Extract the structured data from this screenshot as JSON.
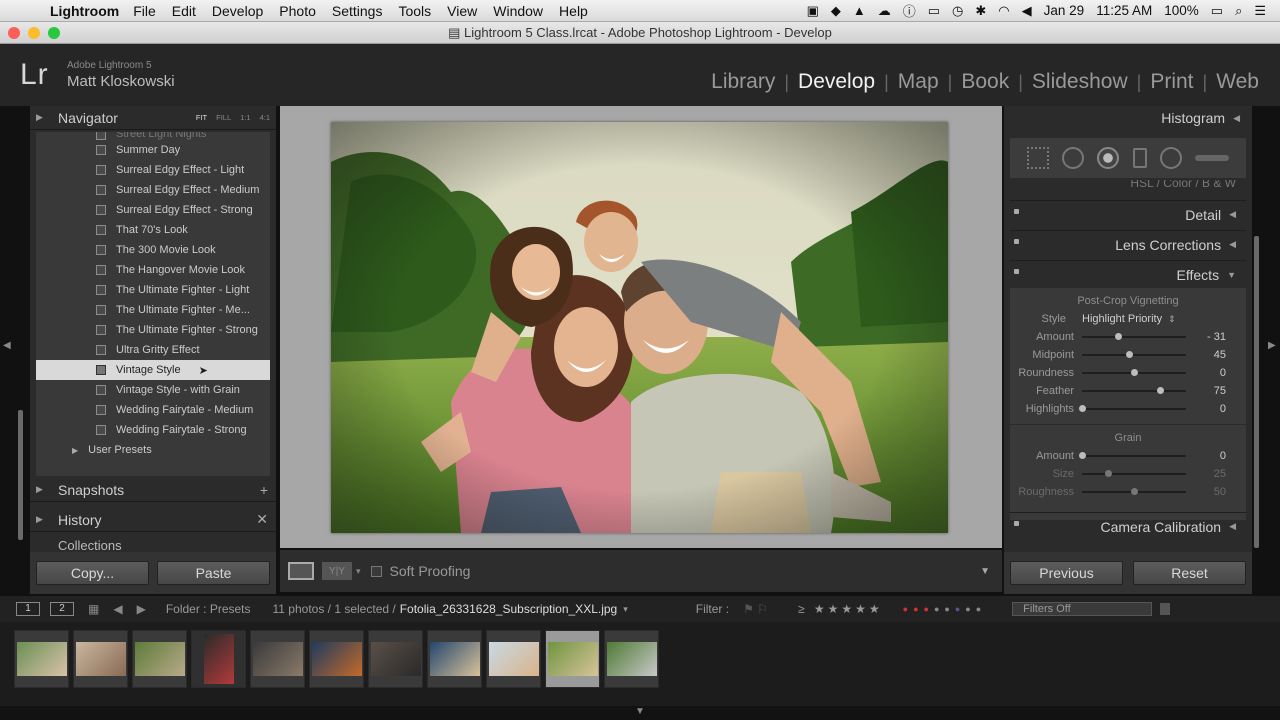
{
  "menubar": {
    "app": "Lightroom",
    "items": [
      "File",
      "Edit",
      "Develop",
      "Photo",
      "Settings",
      "Tools",
      "View",
      "Window",
      "Help"
    ],
    "date": "Jan 29",
    "time": "11:25 AM",
    "battery": "100%"
  },
  "window": {
    "title": "Lightroom 5 Class.lrcat - Adobe Photoshop Lightroom - Develop"
  },
  "identity": {
    "logo": "Lr",
    "version": "Adobe Lightroom 5",
    "user": "Matt Kloskowski"
  },
  "modules": [
    "Library",
    "Develop",
    "Map",
    "Book",
    "Slideshow",
    "Print",
    "Web"
  ],
  "left_panel": {
    "navigator": {
      "label": "Navigator",
      "zoom": [
        "FIT",
        "FILL",
        "1:1",
        "4:1"
      ]
    },
    "presets": [
      "Street Light Nights",
      "Summer Day",
      "Surreal Edgy Effect - Light",
      "Surreal Edgy Effect - Medium",
      "Surreal Edgy Effect - Strong",
      "That 70's Look",
      "The 300 Movie Look",
      "The Hangover Movie Look",
      "The Ultimate Fighter - Light",
      "The Ultimate Fighter - Me...",
      "The Ultimate Fighter - Strong",
      "Ultra Gritty Effect",
      "Vintage Style",
      "Vintage Style - with Grain",
      "Wedding Fairytale - Medium",
      "Wedding Fairytale - Strong"
    ],
    "user_presets": "User Presets",
    "snapshots": "Snapshots",
    "history": "History",
    "collections": "Collections",
    "copy_button": "Copy...",
    "paste_button": "Paste"
  },
  "toolbar": {
    "soft_proofing": "Soft Proofing",
    "yy": "Y|Y"
  },
  "right_panel": {
    "histogram": "Histogram",
    "hsl_tabs": "HSL  /  Color  /  B & W",
    "detail": "Detail",
    "lens_corrections": "Lens Corrections",
    "effects": {
      "label": "Effects",
      "vignette_title": "Post-Crop Vignetting",
      "style_label": "Style",
      "style_value": "Highlight Priority",
      "sliders": [
        {
          "label": "Amount",
          "value": "- 31",
          "pos": 0.345
        },
        {
          "label": "Midpoint",
          "value": "45",
          "pos": 0.45
        },
        {
          "label": "Roundness",
          "value": "0",
          "pos": 0.5
        },
        {
          "label": "Feather",
          "value": "75",
          "pos": 0.75
        },
        {
          "label": "Highlights",
          "value": "0",
          "pos": 0.0
        }
      ],
      "grain_title": "Grain",
      "grain": [
        {
          "label": "Amount",
          "value": "0",
          "pos": 0.0
        },
        {
          "label": "Size",
          "value": "25",
          "pos": 0.25
        },
        {
          "label": "Roughness",
          "value": "50",
          "pos": 0.5
        }
      ]
    },
    "camera_calibration": "Camera Calibration",
    "previous_button": "Previous",
    "reset_button": "Reset"
  },
  "filmstrip": {
    "page1": "1",
    "page2": "2",
    "folder": "Folder : Presets",
    "count": "11 photos / 1 selected /",
    "filename": "Fotolia_26331628_Subscription_XXL.jpg",
    "filter_label": "Filter :",
    "stars": "≥ ★★★★★",
    "filters_off": "Filters Off",
    "thumbs": [
      "family",
      "couple",
      "outdoor",
      "fashion",
      "tunnel",
      "skate",
      "hallway",
      "coast",
      "beach",
      "selected",
      "dogs"
    ]
  }
}
